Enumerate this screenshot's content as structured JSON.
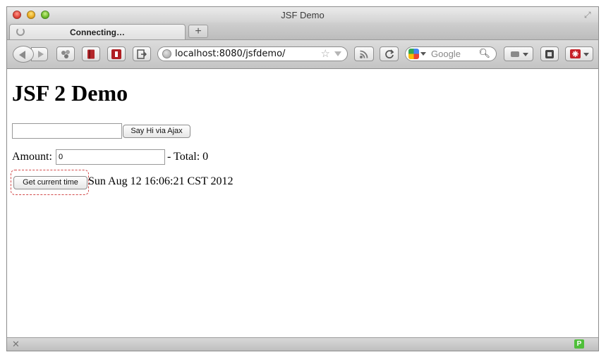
{
  "window": {
    "title": "JSF Demo"
  },
  "tabs": [
    {
      "label": "Connecting…"
    }
  ],
  "toolbar": {
    "url": "localhost:8080/jsfdemo/",
    "search_placeholder": "Google"
  },
  "page": {
    "heading": "JSF 2 Demo",
    "name_input_value": "",
    "say_hi_label": "Say Hi via Ajax",
    "amount_label": "Amount:",
    "amount_value": "0",
    "total_text": "- Total: 0",
    "time_button_label": "Get current time",
    "current_time_text": "Sun Aug 12 16:06:21 CST 2012"
  },
  "icons": {
    "back": "back-arrow-icon",
    "forward": "forward-arrow-icon",
    "reload": "reload-icon",
    "rss": "rss-icon",
    "status_plugin": "p-badge-icon"
  }
}
